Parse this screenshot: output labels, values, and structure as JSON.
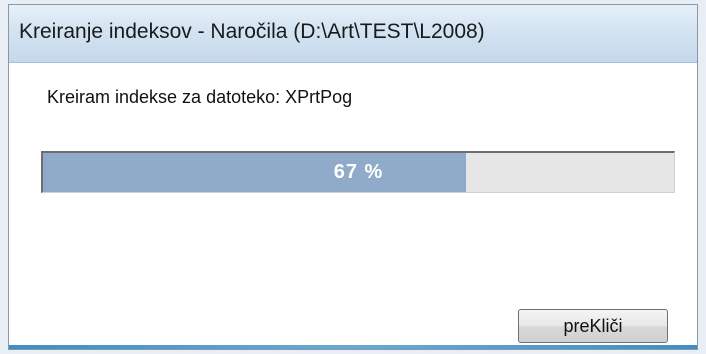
{
  "window": {
    "title": "Kreiranje indeksov - Naročila (D:\\Art\\TEST\\L2008)"
  },
  "dialog": {
    "message": "Kreiram indekse za datoteko: XPrtPog",
    "progress": {
      "percent": 67,
      "label": "67 %"
    },
    "cancel_label": "preKliči"
  },
  "colors": {
    "progress_fill": "#8fabc9",
    "progress_track": "#e6e6e6",
    "titlebar": "#d3e3f2"
  }
}
